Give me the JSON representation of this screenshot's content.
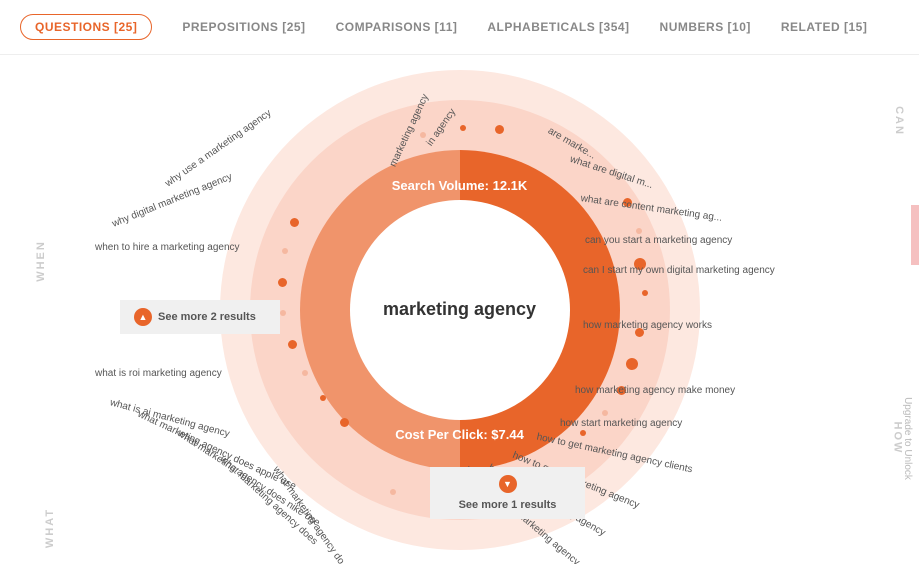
{
  "tabs": [
    {
      "id": "questions",
      "label": "QUESTIONS [25]",
      "active": true
    },
    {
      "id": "prepositions",
      "label": "PREPOSITIONS [25]",
      "active": false
    },
    {
      "id": "comparisons",
      "label": "COMPARISONS [11]",
      "active": false
    },
    {
      "id": "alphabeticals",
      "label": "ALPHABETICALS [354]",
      "active": false
    },
    {
      "id": "numbers",
      "label": "NUMBERS [10]",
      "active": false
    },
    {
      "id": "related",
      "label": "RELATED [15]",
      "active": false
    }
  ],
  "center": {
    "keyword": "marketing\nagency",
    "search_volume": "Search Volume: 12.1K",
    "cpc": "Cost Per Click: $7.44"
  },
  "section_labels": {
    "when": "WHEN",
    "what": "WHAT",
    "how": "HOW",
    "can": "CAN"
  },
  "see_more_left": "See more 2 results",
  "see_more_bottom": "See more 1 results",
  "upgrade_label": "Upgrade to Unlock",
  "keywords_left": [
    "why use a marketing agency",
    "why digital marketing agency",
    "when to hire a marketing agency",
    "what is roi marketing agency",
    "what is ai marketing agency",
    "what marketing agency does apple use",
    "what marketing agency does nike use",
    "what marketing agency does",
    "what marketing agency do"
  ],
  "keywords_right": [
    "are marke...",
    "what are digital m...",
    "what are content marketing ag...",
    "can you start a marketing agency",
    "can I start my own digital marketing agency",
    "how marketing agency works",
    "how marketing agency make money",
    "how start marketing agency",
    "how to get marketing agency clients",
    "how to grow marketing agency",
    "how to train marketing agency",
    "how to running marketing agency"
  ],
  "keywords_top": [
    "marketing agency",
    "in agency"
  ]
}
